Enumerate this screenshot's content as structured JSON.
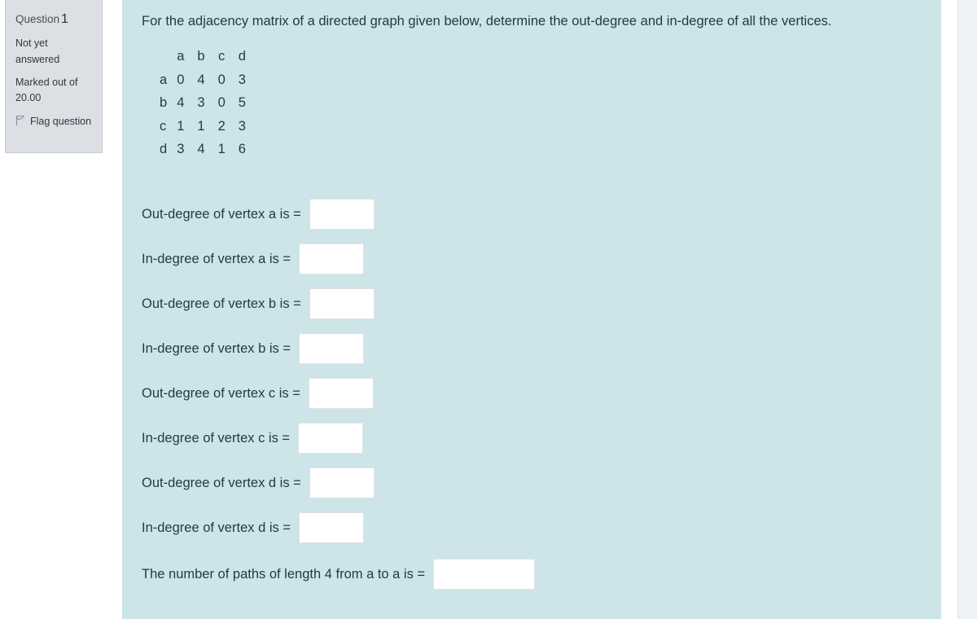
{
  "question_info": {
    "title_label": "Question",
    "number": "1",
    "status": "Not yet answered",
    "marks": "Marked out of 20.00",
    "flag_label": "Flag question",
    "flag_icon": "flag-icon"
  },
  "content": {
    "question_text": "For the adjacency matrix of a directed graph given below, determine the out-degree and in-degree of all the vertices.",
    "matrix": {
      "corner": "",
      "column_headers": [
        "a",
        "b",
        "c",
        "d"
      ],
      "row_labels": [
        "a",
        "b",
        "c",
        "d"
      ],
      "rows": [
        [
          "0",
          "4",
          "0",
          "3"
        ],
        [
          "4",
          "3",
          "0",
          "5"
        ],
        [
          "1",
          "1",
          "2",
          "3"
        ],
        [
          "3",
          "4",
          "1",
          "6"
        ]
      ]
    },
    "answer_rows": [
      {
        "label": "Out-degree of vertex a is =",
        "value": "",
        "size": "w-sm"
      },
      {
        "label": "In-degree of vertex a is =",
        "value": "",
        "size": "w-sm"
      },
      {
        "label": "Out-degree of vertex b is =",
        "value": "",
        "size": "w-sm"
      },
      {
        "label": "In-degree of vertex b is =",
        "value": "",
        "size": "w-sm"
      },
      {
        "label": "Out-degree of vertex c is =",
        "value": "",
        "size": "w-sm"
      },
      {
        "label": "In-degree of vertex c is =",
        "value": "",
        "size": "w-sm"
      },
      {
        "label": "Out-degree of vertex d is =",
        "value": "",
        "size": "w-sm"
      },
      {
        "label": "In-degree of vertex d is =",
        "value": "",
        "size": "w-sm"
      },
      {
        "label": "The number of paths of length 4 from a to a is =",
        "value": "",
        "size": "w-lg"
      }
    ]
  },
  "colors": {
    "content_background": "#cde4e8",
    "sidebar_background": "#dcdfe4",
    "text": "#1d3b47",
    "input_background": "#ffffff",
    "input_border": "#dfe3e6"
  }
}
